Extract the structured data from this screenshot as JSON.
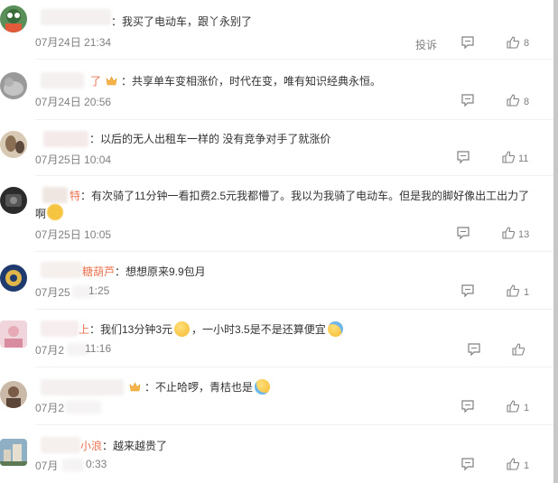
{
  "comments": [
    {
      "text": "：我买了电动车，跟丫永别了",
      "time": "07月24日 21:34",
      "report_label": "投诉",
      "likes": "8"
    },
    {
      "name_tail": "了",
      "text": "：共享单车变相涨价，时代在变，唯有知识经典永恒。",
      "time": "07月24日 20:56",
      "likes": "8"
    },
    {
      "text": "：以后的无人出租车一样的 没有竞争对手了就涨价",
      "time": "07月25日 10:04",
      "likes": "11"
    },
    {
      "name_tail": "特",
      "text_line1": "：有次骑了11分钟一看扣费2.5元我都懵了。我以为我骑了电动车。但是我的脚好像出工出力了",
      "text_line2": "啊",
      "time": "07月25日 10:05",
      "likes": "13"
    },
    {
      "name_tail": "糖葫芦",
      "text": "：想想原来9.9包月",
      "time_prefix": "07月25",
      "time_suffix": "1:25",
      "likes": "1"
    },
    {
      "name_tail": "上",
      "text_a": "：我们13分钟3元",
      "text_b": "，一小时3.5是不是还算便宜",
      "time_prefix": "07月2",
      "time_suffix": "11:16",
      "likes": ""
    },
    {
      "text": "：不止哈啰，青桔也是",
      "time_prefix": "07月2",
      "likes": "1"
    },
    {
      "name_tail": "小浪",
      "text": "：越来越贵了",
      "time_prefix": "07月",
      "time_suffix": "0:33",
      "likes": "1"
    }
  ],
  "colors": {
    "name": "#eb7350",
    "text": "#333333",
    "meta": "#808080",
    "divider": "#f0f0f0"
  },
  "icons": {
    "reply": "comment-bubble-icon",
    "like": "thumbs-up-icon",
    "badge": "crown-badge-icon"
  }
}
